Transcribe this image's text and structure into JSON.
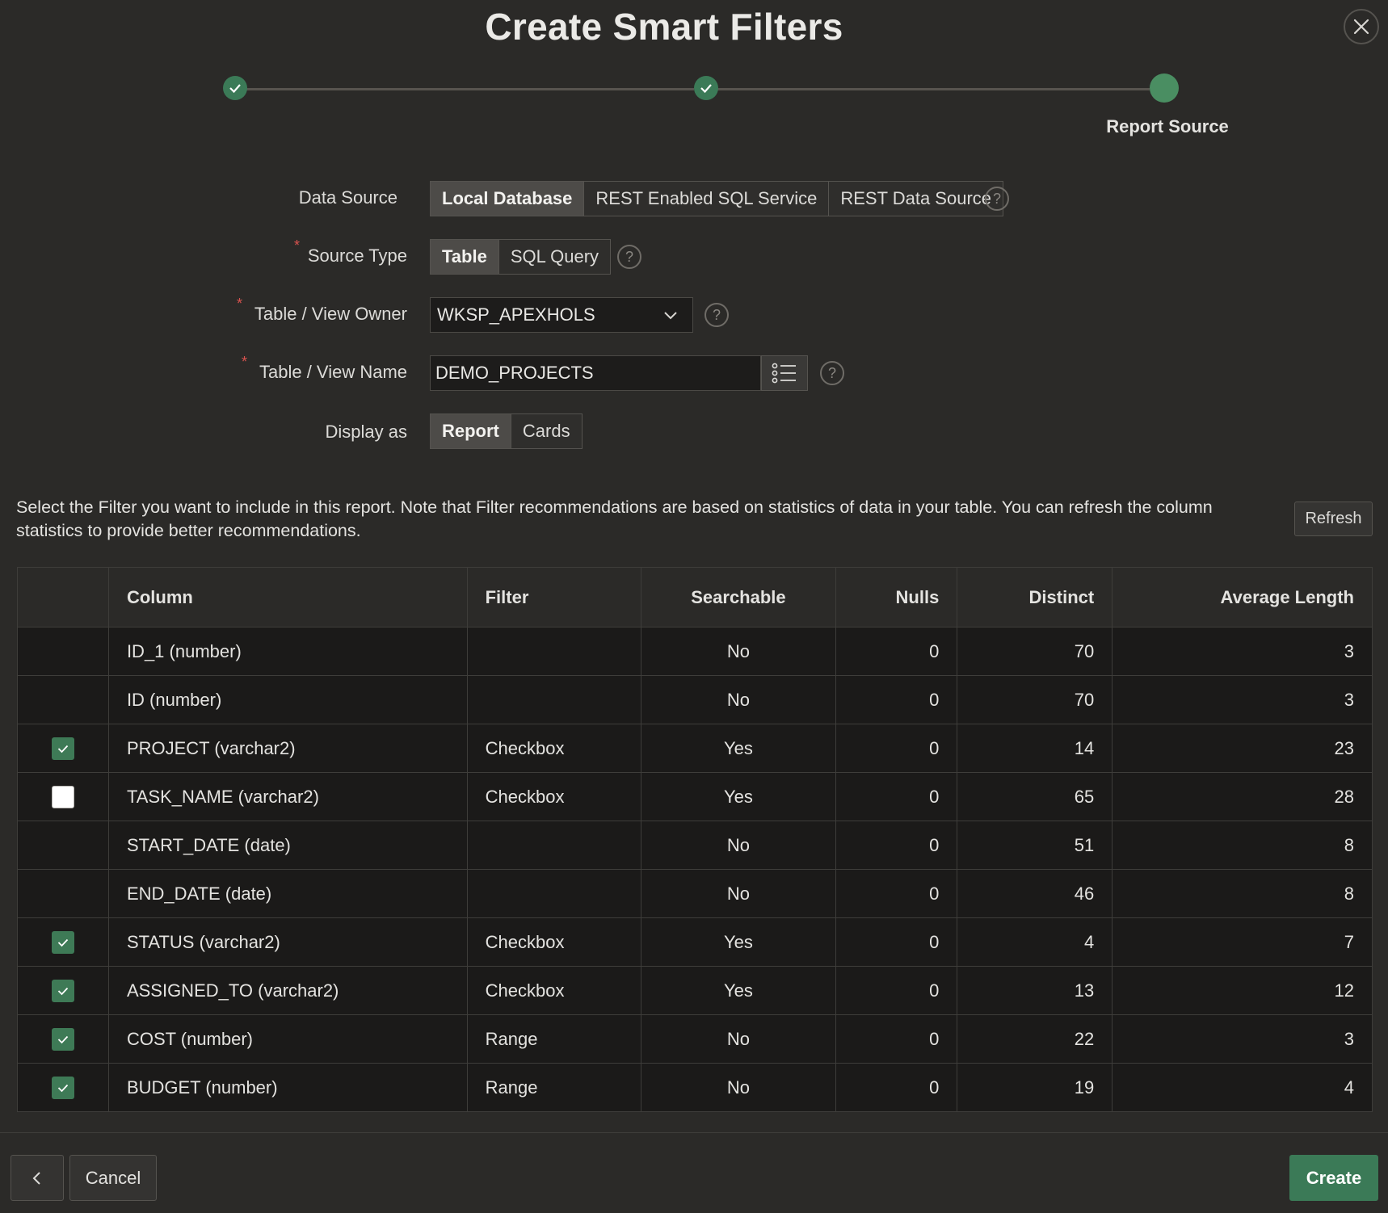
{
  "dialog": {
    "title": "Create Smart Filters"
  },
  "wizard": {
    "current_step_label": "Report Source"
  },
  "form": {
    "data_source": {
      "label": "Data Source",
      "options": [
        "Local Database",
        "REST Enabled SQL Service",
        "REST Data Source"
      ],
      "selected": "Local Database"
    },
    "source_type": {
      "label": "Source Type",
      "required_mark": "*",
      "options": [
        "Table",
        "SQL Query"
      ],
      "selected": "Table"
    },
    "table_owner": {
      "label": "Table / View Owner",
      "required_mark": "*",
      "value": "WKSP_APEXHOLS"
    },
    "table_name": {
      "label": "Table / View Name",
      "required_mark": "*",
      "value": "DEMO_PROJECTS"
    },
    "display_as": {
      "label": "Display as",
      "options": [
        "Report",
        "Cards"
      ],
      "selected": "Report"
    },
    "help_glyph": "?"
  },
  "description": "Select the Filter you want to include in this report. Note that Filter recommendations are based on statistics of data in your table. You can refresh the column statistics to provide better recommendations.",
  "refresh_label": "Refresh",
  "table": {
    "headers": {
      "select": "",
      "column": "Column",
      "filter": "Filter",
      "searchable": "Searchable",
      "nulls": "Nulls",
      "distinct": "Distinct",
      "avg_length": "Average Length"
    },
    "rows": [
      {
        "checkbox": "none",
        "column": "ID_1 (number)",
        "filter": "",
        "searchable": "No",
        "nulls": "0",
        "distinct": "70",
        "avg_length": "3"
      },
      {
        "checkbox": "none",
        "column": "ID (number)",
        "filter": "",
        "searchable": "No",
        "nulls": "0",
        "distinct": "70",
        "avg_length": "3"
      },
      {
        "checkbox": "checked",
        "column": "PROJECT (varchar2)",
        "filter": "Checkbox",
        "searchable": "Yes",
        "nulls": "0",
        "distinct": "14",
        "avg_length": "23"
      },
      {
        "checkbox": "unchecked",
        "column": "TASK_NAME (varchar2)",
        "filter": "Checkbox",
        "searchable": "Yes",
        "nulls": "0",
        "distinct": "65",
        "avg_length": "28"
      },
      {
        "checkbox": "none",
        "column": "START_DATE (date)",
        "filter": "",
        "searchable": "No",
        "nulls": "0",
        "distinct": "51",
        "avg_length": "8"
      },
      {
        "checkbox": "none",
        "column": "END_DATE (date)",
        "filter": "",
        "searchable": "No",
        "nulls": "0",
        "distinct": "46",
        "avg_length": "8"
      },
      {
        "checkbox": "checked",
        "column": "STATUS (varchar2)",
        "filter": "Checkbox",
        "searchable": "Yes",
        "nulls": "0",
        "distinct": "4",
        "avg_length": "7"
      },
      {
        "checkbox": "checked",
        "column": "ASSIGNED_TO (varchar2)",
        "filter": "Checkbox",
        "searchable": "Yes",
        "nulls": "0",
        "distinct": "13",
        "avg_length": "12"
      },
      {
        "checkbox": "checked",
        "column": "COST (number)",
        "filter": "Range",
        "searchable": "No",
        "nulls": "0",
        "distinct": "22",
        "avg_length": "3"
      },
      {
        "checkbox": "checked",
        "column": "BUDGET (number)",
        "filter": "Range",
        "searchable": "No",
        "nulls": "0",
        "distinct": "19",
        "avg_length": "4"
      }
    ]
  },
  "footer": {
    "cancel_label": "Cancel",
    "create_label": "Create"
  },
  "colors": {
    "background": "#2b2a28",
    "accent_green": "#3b7a57",
    "table_cell": "#1b1a19"
  }
}
